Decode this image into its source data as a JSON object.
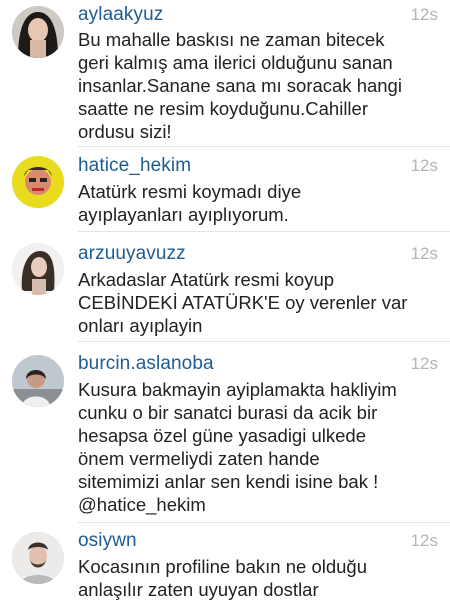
{
  "comments": [
    {
      "username": "aylaakyuz",
      "time": "12s",
      "text": "Bu mahalle baskısı ne zaman bitecek\ngeri kalmış ama ilerici olduğunu sanan\ninsanlar.Sanane sana mı soracak hangi\nsaatte ne resim koyduğunu.Cahiller\nordusu sizi!"
    },
    {
      "username": "hatice_hekim",
      "time": "12s",
      "text": "Atatürk resmi koymadı diye\nayıplayanları ayıplıyorum."
    },
    {
      "username": "arzuuyavuzz",
      "time": "12s",
      "text": "Arkadaslar Atatürk resmi koyup\nCEBİNDEKİ ATATÜRK'E oy verenler var\nonları ayıplayin"
    },
    {
      "username": "burcin.aslanoba",
      "time": "12s",
      "text": "Kusura bakmayin ayiplamakta hakliyim\ncunku o bir sanatci burasi da acik bir\nhesapsa özel güne yasadigi ulkede\nönem vermeliydi zaten hande\nsitemimizi anlar sen kendi isine bak !",
      "mention": "@hatice_hekim"
    },
    {
      "username": "osiywn",
      "time": "12s",
      "text": "Kocasının profiline bakın ne olduğu\nanlaşılır zaten uyuyan dostlar"
    }
  ]
}
